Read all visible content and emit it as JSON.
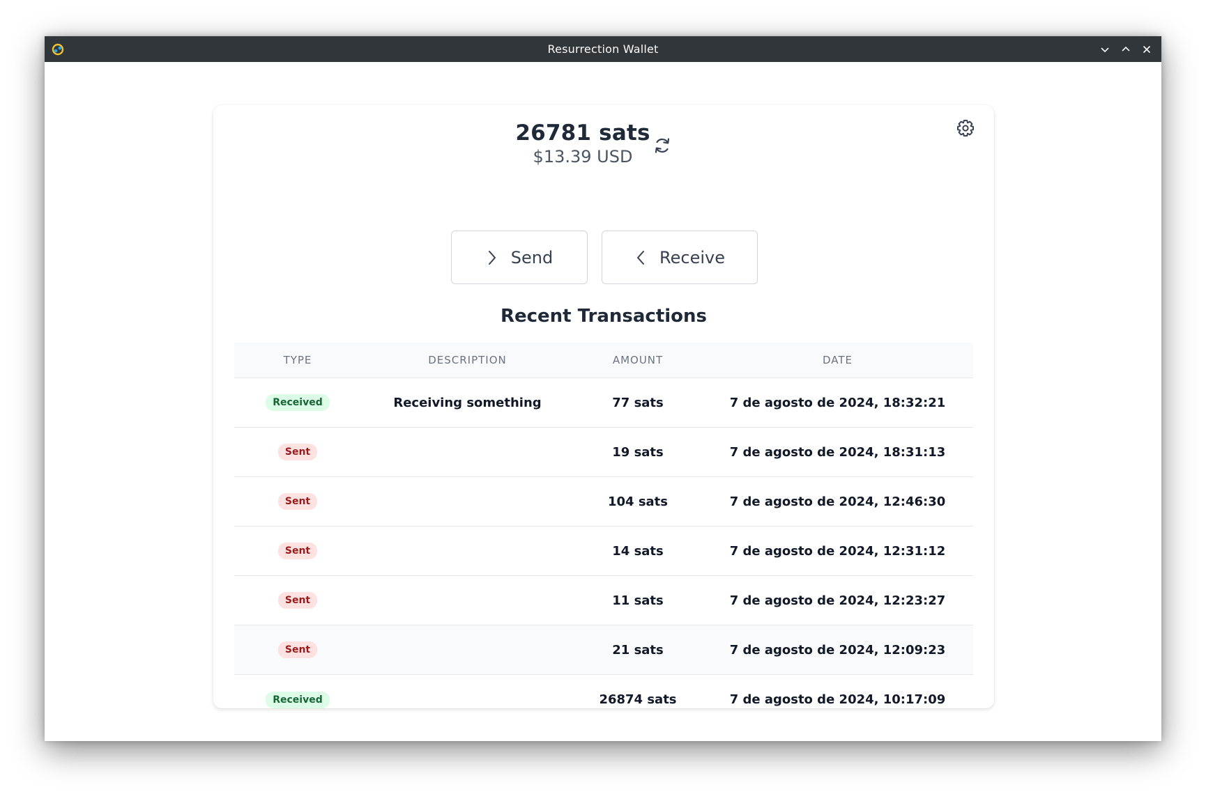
{
  "window": {
    "title": "Resurrection Wallet"
  },
  "balance": {
    "sats": "26781 sats",
    "usd": "$13.39 USD"
  },
  "actions": {
    "send_label": "Send",
    "receive_label": "Receive"
  },
  "transactions": {
    "title": "Recent Transactions",
    "columns": [
      "TYPE",
      "DESCRIPTION",
      "AMOUNT",
      "DATE"
    ],
    "rows": [
      {
        "type": "Received",
        "description": "Receiving something",
        "amount": "77 sats",
        "date": "7 de agosto de 2024, 18:32:21"
      },
      {
        "type": "Sent",
        "description": "",
        "amount": "19 sats",
        "date": "7 de agosto de 2024, 18:31:13"
      },
      {
        "type": "Sent",
        "description": "",
        "amount": "104 sats",
        "date": "7 de agosto de 2024, 12:46:30"
      },
      {
        "type": "Sent",
        "description": "",
        "amount": "14 sats",
        "date": "7 de agosto de 2024, 12:31:12"
      },
      {
        "type": "Sent",
        "description": "",
        "amount": "11 sats",
        "date": "7 de agosto de 2024, 12:23:27"
      },
      {
        "type": "Sent",
        "description": "",
        "amount": "21 sats",
        "date": "7 de agosto de 2024, 12:09:23"
      },
      {
        "type": "Received",
        "description": "",
        "amount": "26874 sats",
        "date": "7 de agosto de 2024, 10:17:09"
      }
    ]
  },
  "icons": {
    "app": "app-icon",
    "minimize": "chevron-down-icon",
    "maximize": "chevron-up-icon",
    "close": "close-icon",
    "refresh": "refresh-icon",
    "settings": "gear-icon",
    "send": "chevron-right-icon",
    "receive": "chevron-left-icon"
  },
  "colors": {
    "titlebar": "#31363b",
    "received_badge_bg": "#dcfce7",
    "received_badge_text": "#166534",
    "sent_badge_bg": "#fee2e2",
    "sent_badge_text": "#991b1b"
  }
}
